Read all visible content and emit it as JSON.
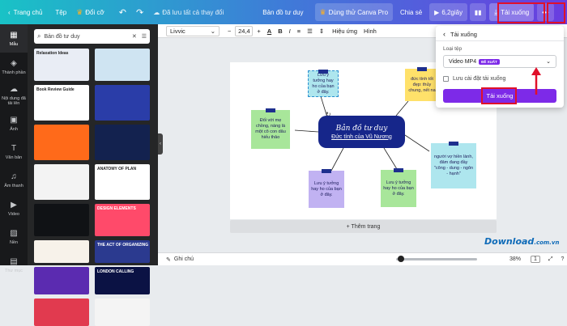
{
  "topbar": {
    "home": "Trang chủ",
    "file": "Tệp",
    "resize": "Đổi cỡ",
    "saved": "Đã lưu tất cả thay đổi",
    "doc_title": "Bản đồ tư duy",
    "try_pro": "Dùng thử Canva Pro",
    "share": "Chia sẻ",
    "play": "6,2giây",
    "download": "Tải xuống",
    "more": "•••"
  },
  "leftnav": {
    "items": [
      {
        "label": "Mẫu",
        "icon": "template-icon"
      },
      {
        "label": "Thành phần",
        "icon": "elements-icon"
      },
      {
        "label": "Nội dung đã tải lên",
        "icon": "upload-icon"
      },
      {
        "label": "Ảnh",
        "icon": "photo-icon"
      },
      {
        "label": "Văn bản",
        "icon": "text-icon"
      },
      {
        "label": "Âm thanh",
        "icon": "audio-icon"
      },
      {
        "label": "Video",
        "icon": "video-icon"
      },
      {
        "label": "Nền",
        "icon": "background-icon"
      },
      {
        "label": "Thư mục",
        "icon": "folder-icon"
      }
    ]
  },
  "panel": {
    "search_value": "Bản đồ tư duy",
    "thumbs": [
      {
        "text": "Relaxation Ideas",
        "bg": "#e9edf5"
      },
      {
        "text": "",
        "bg": "#cfe4f2"
      },
      {
        "text": "Book Review Guide",
        "bg": "#ffffff"
      },
      {
        "text": "",
        "bg": "#2a3da8"
      },
      {
        "text": "",
        "bg": "#ff6a1a"
      },
      {
        "text": "",
        "bg": "#13224f"
      },
      {
        "text": "",
        "bg": "#f3f3f3"
      },
      {
        "text": "ANATOMY OF PLAN",
        "bg": "#ffffff"
      },
      {
        "text": "",
        "bg": "#101215"
      },
      {
        "text": "DESIGN ELEMENTS",
        "bg": "#ff4a6a"
      },
      {
        "text": "",
        "bg": "#f7f2ea"
      },
      {
        "text": "THE ACT OF ORGANIZING",
        "bg": "#2b3a8f"
      },
      {
        "text": "",
        "bg": "#5b2bb0"
      },
      {
        "text": "LONDON CALLING",
        "bg": "#0b1244"
      },
      {
        "text": "",
        "bg": "#e13a4f"
      },
      {
        "text": "",
        "bg": "#f4f4f4"
      }
    ]
  },
  "toolbar2": {
    "font": "Livvic",
    "size": "24,4",
    "effects": "Hiệu ứng",
    "animate": "Hình"
  },
  "canvas": {
    "center_title": "Bản đồ tư duy",
    "center_sub": "Đức tính của Vũ Nương",
    "notes": [
      "Lưu ý tưởng hay ho của bạn ở đây.",
      "Đối với mẹ chồng, nàng là một cô con dâu hiếu thảo",
      "đức tính tốt đẹp: thủy chung, nết na",
      "người vợ hiền lành, đảm đang đầy \"công - dung - ngôn - hạnh\"",
      "Lưu ý tưởng hay ho của bạn ở đây.",
      "Lưu ý tưởng hay ho của bạn ở đây."
    ],
    "add_page": "+ Thêm trang"
  },
  "dropdown": {
    "header": "Tải xuống",
    "file_type_label": "Loại tệp",
    "file_type": "Video MP4",
    "badge": "ĐỀ XUẤT",
    "save_settings": "Lưu cài đặt tải xuống",
    "download_btn": "Tải xuống"
  },
  "footer": {
    "notes": "Ghi chú",
    "zoom": "38%",
    "page": "1"
  },
  "watermark": {
    "brand": "Download",
    "tld": ".com.vn"
  },
  "colors": {
    "accent": "#7d2ae8",
    "highlight": "#e0102a",
    "center_box": "#16268a"
  }
}
